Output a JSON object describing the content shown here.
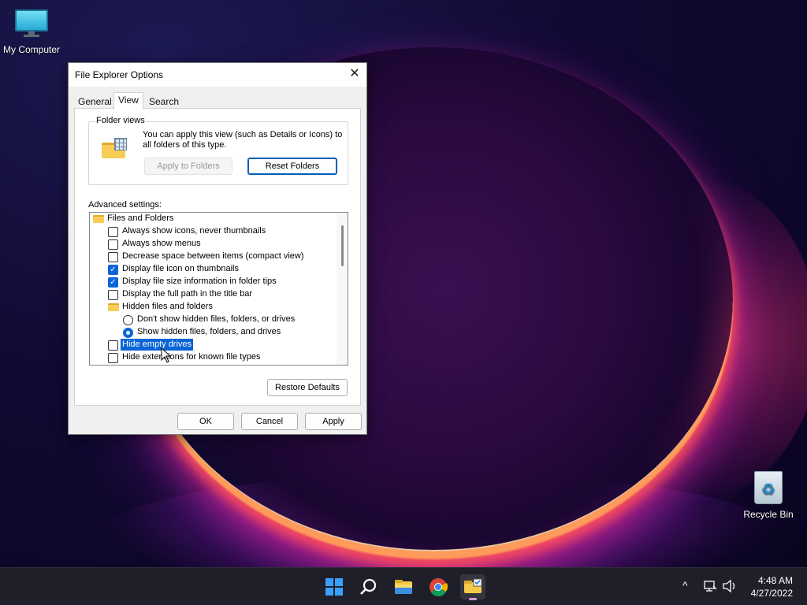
{
  "desktop": {
    "icons": [
      {
        "label": "My Computer"
      },
      {
        "label": "Recycle Bin"
      }
    ]
  },
  "dialog": {
    "title": "File Explorer Options",
    "tabs": [
      "General",
      "View",
      "Search"
    ],
    "active_tab": "View",
    "folder_views": {
      "legend": "Folder views",
      "description": "You can apply this view (such as Details or Icons) to all folders of this type.",
      "apply_button": "Apply to Folders",
      "reset_button": "Reset Folders"
    },
    "advanced_label": "Advanced settings:",
    "settings": [
      {
        "type": "folder",
        "label": "Files and Folders"
      },
      {
        "type": "checkbox",
        "checked": false,
        "label": "Always show icons, never thumbnails"
      },
      {
        "type": "checkbox",
        "checked": false,
        "label": "Always show menus"
      },
      {
        "type": "checkbox",
        "checked": false,
        "label": "Decrease space between items (compact view)"
      },
      {
        "type": "checkbox",
        "checked": true,
        "label": "Display file icon on thumbnails"
      },
      {
        "type": "checkbox",
        "checked": true,
        "label": "Display file size information in folder tips"
      },
      {
        "type": "checkbox",
        "checked": false,
        "label": "Display the full path in the title bar"
      },
      {
        "type": "folder",
        "label": "Hidden files and folders"
      },
      {
        "type": "radio",
        "checked": false,
        "label": "Don't show hidden files, folders, or drives"
      },
      {
        "type": "radio",
        "checked": true,
        "label": "Show hidden files, folders, and drives"
      },
      {
        "type": "checkbox",
        "checked": false,
        "selected": true,
        "label": "Hide empty drives"
      },
      {
        "type": "checkbox",
        "checked": false,
        "label": "Hide extensions for known file types"
      }
    ],
    "restore_button": "Restore Defaults",
    "ok_button": "OK",
    "cancel_button": "Cancel",
    "apply_button": "Apply"
  },
  "taskbar": {
    "apps": [
      "start-icon",
      "search-icon",
      "file-explorer-icon",
      "chrome-icon",
      "explorer-options-icon"
    ],
    "time": "4:48 AM",
    "date": "4/27/2022"
  }
}
